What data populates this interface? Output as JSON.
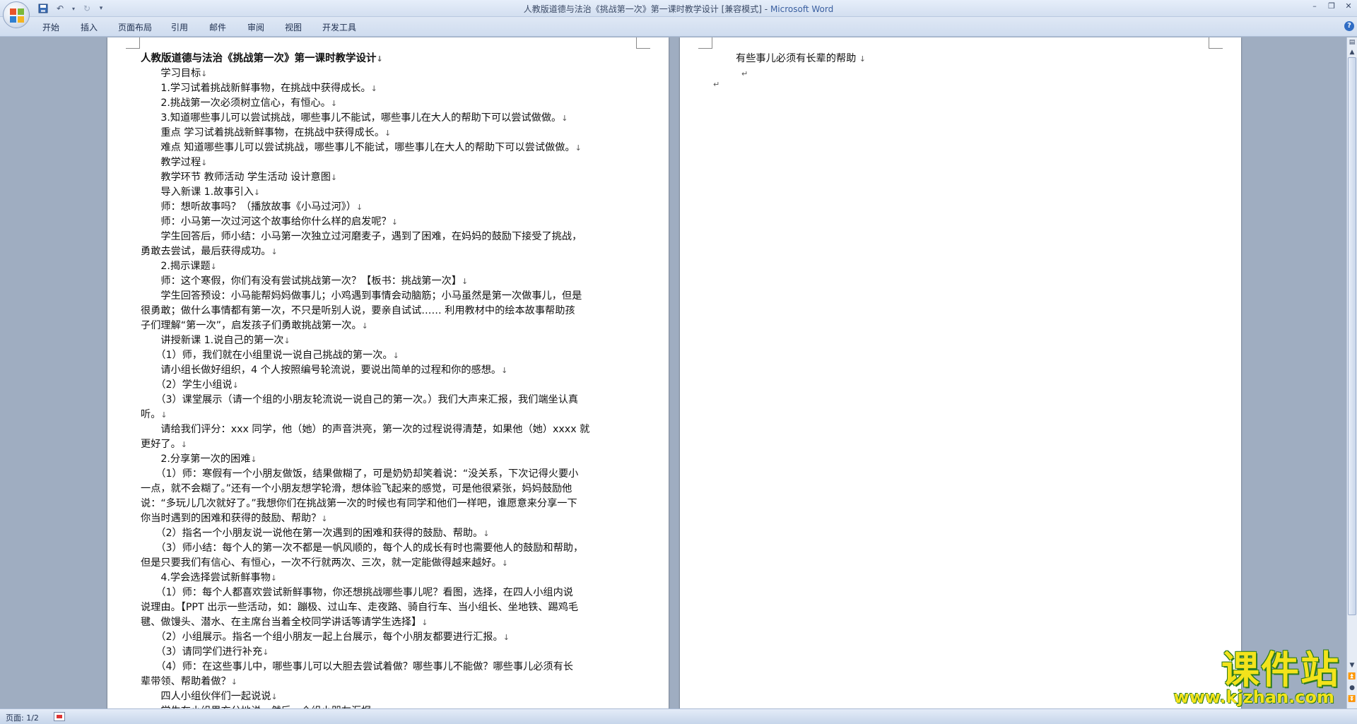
{
  "window": {
    "title_doc": "人教版道德与法治《挑战第一次》第一课时教学设计 [兼容模式]",
    "title_sep": " - ",
    "title_app": "Microsoft Word"
  },
  "ribbon": {
    "tabs": [
      "开始",
      "插入",
      "页面布局",
      "引用",
      "邮件",
      "审阅",
      "视图",
      "开发工具"
    ]
  },
  "document": {
    "page1_lines": [
      "人教版道德与法治《挑战第一次》第一课时教学设计",
      "　　学习目标",
      "　　1.学习试着挑战新鲜事物，在挑战中获得成长。",
      "　　2.挑战第一次必须树立信心，有恒心。",
      "　　3.知道哪些事儿可以尝试挑战，哪些事儿不能试，哪些事儿在大人的帮助下可以尝试做做。",
      "　　重点 学习试着挑战新鲜事物，在挑战中获得成长。",
      "　　难点 知道哪些事儿可以尝试挑战，哪些事儿不能试，哪些事儿在大人的帮助下可以尝试做做。",
      "　　教学过程",
      "　　教学环节 教师活动 学生活动 设计意图",
      "　　导入新课 1.故事引入",
      "　　师：想听故事吗？（播放故事《小马过河》）",
      "　　师：小马第一次过河这个故事给你什么样的启发呢？",
      "　　学生回答后，师小结：小马第一次独立过河磨麦子，遇到了困难，在妈妈的鼓励下接受了挑战，",
      "勇敢去尝试，最后获得成功。",
      "　　2.揭示课题",
      "　　师：这个寒假，你们有没有尝试挑战第一次？【板书：挑战第一次】",
      "　　学生回答预设：小马能帮妈妈做事儿；小鸡遇到事情会动脑筋；小马虽然是第一次做事儿，但是",
      "很勇敢；做什么事情都有第一次，不只是听别人说，要亲自试试…… 利用教材中的绘本故事帮助孩",
      "子们理解“第一次”，启发孩子们勇敢挑战第一次。",
      "　　讲授新课 1.说自己的第一次",
      "　　（1）师，我们就在小组里说一说自己挑战的第一次。",
      "　　请小组长做好组织，4 个人按照编号轮流说，要说出简单的过程和你的感想。",
      "　　（2）学生小组说",
      "　　（3）课堂展示（请一个组的小朋友轮流说一说自己的第一次。）我们大声来汇报，我们端坐认真",
      "听。",
      "　　请给我们评分：xxx 同学，他（她）的声音洪亮，第一次的过程说得清楚，如果他（她）xxxx 就",
      "更好了。",
      "　　2.分享第一次的困难",
      "　　（1）师：寒假有一个小朋友做饭，结果做糊了，可是奶奶却笑着说：“没关系，下次记得火要小",
      "一点，就不会糊了。”还有一个小朋友想学轮滑，想体验飞起来的感觉，可是他很紧张，妈妈鼓励他",
      "说：“多玩儿几次就好了。”我想你们在挑战第一次的时候也有同学和他们一样吧，谁愿意来分享一下",
      "你当时遇到的困难和获得的鼓励、帮助？",
      "　　（2）指名一个小朋友说一说他在第一次遇到的困难和获得的鼓励、帮助。",
      "　　（3）师小结：每个人的第一次不都是一帆风顺的，每个人的成长有时也需要他人的鼓励和帮助，",
      "但是只要我们有信心、有恒心，一次不行就两次、三次，就一定能做得越来越好。",
      "　　4.学会选择尝试新鲜事物",
      "　　（1）师：每个人都喜欢尝试新鲜事物，你还想挑战哪些事儿呢？看图，选择，在四人小组内说",
      "说理由。【PPT 出示一些活动，如：蹦极、过山车、走夜路、骑自行车、当小组长、坐地铁、踢鸡毛",
      "毽、做馒头、潜水、在主席台当着全校同学讲话等请学生选择】",
      "　　（2）小组展示。指名一个组小朋友一起上台展示，每个小朋友都要进行汇报。",
      "　　（3）请同学们进行补充",
      "　　（4）师：在这些事儿中，哪些事儿可以大胆去尝试着做？哪些事儿不能做？哪些事儿必须有长",
      "辈带领、帮助着做？",
      "　　四人小组伙伴们一起说说",
      "　　学生在小组里充分地说，然后一个组小朋友汇报。"
    ],
    "page1_marks": [
      "↓",
      "↓",
      "↓",
      "↓",
      "↓",
      "↓",
      "↓",
      "↓",
      "↓",
      "↓",
      "↓",
      "↓",
      "",
      "↓",
      "↓",
      "↓",
      "",
      "",
      "↓",
      "↓",
      "↓",
      "↓",
      "↓",
      "",
      "↓",
      "",
      "↓",
      "↓",
      "",
      "",
      "",
      "↓",
      "↓",
      "",
      "↓",
      "↓",
      "",
      "",
      "↓",
      "↓",
      "↓",
      "",
      "↓",
      "↓",
      "↓"
    ],
    "page2_line": "有些事儿必须有长辈的帮助",
    "page2_mark": "↓",
    "page2_empty_mark": "↵",
    "page2_end_mark": "↵"
  },
  "statusbar": {
    "page_info": "页面: 1/2"
  },
  "watermark": {
    "main": "课件站",
    "url": "www.kjzhan.com"
  },
  "colors": {
    "background": "#9fadc1",
    "watermark": "#f3e31b",
    "watermark_outline": "#2a7a1e"
  }
}
